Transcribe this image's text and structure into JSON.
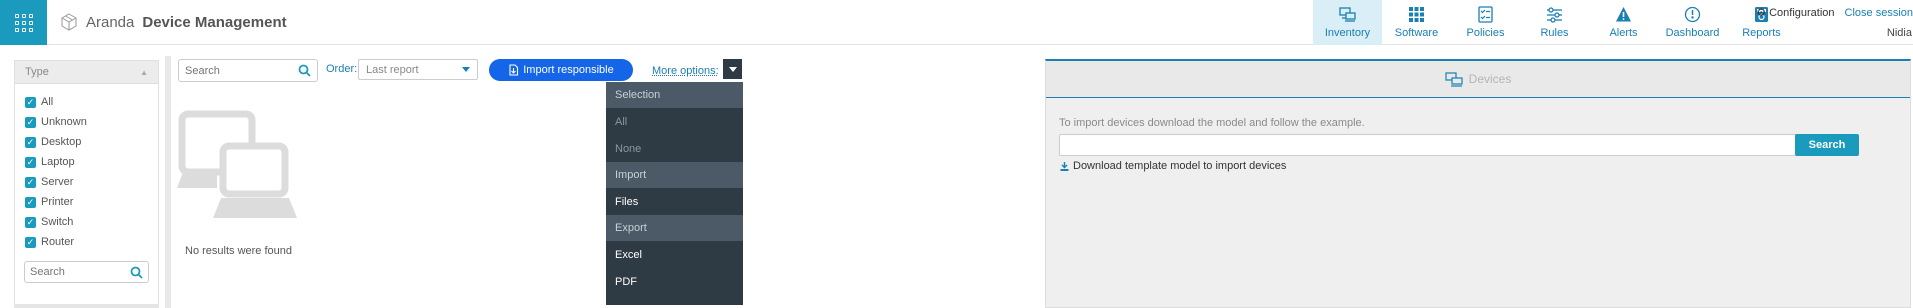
{
  "header": {
    "brand_light": "Aranda",
    "brand_bold": "Device Management",
    "nav": [
      {
        "label": "Inventory",
        "icon": "inventory-icon",
        "active": true
      },
      {
        "label": "Software",
        "icon": "software-icon",
        "active": false
      },
      {
        "label": "Policies",
        "icon": "policies-icon",
        "active": false
      },
      {
        "label": "Rules",
        "icon": "rules-icon",
        "active": false
      },
      {
        "label": "Alerts",
        "icon": "alerts-icon",
        "active": false
      },
      {
        "label": "Dashboard",
        "icon": "dashboard-icon",
        "active": false
      },
      {
        "label": "Reports",
        "icon": "reports-icon",
        "active": false
      }
    ],
    "configuration": "Configuration",
    "close_session": "Close session",
    "user": "Nidia"
  },
  "filter": {
    "title": "Type",
    "items": [
      "All",
      "Unknown",
      "Desktop",
      "Laptop",
      "Server",
      "Printer",
      "Switch",
      "Router"
    ],
    "search_placeholder": "Search"
  },
  "toolbar": {
    "search_placeholder": "Search",
    "order_label": "Order:",
    "order_value": "Last report",
    "import_label": "Import responsible",
    "more_options": "More options:"
  },
  "results": {
    "empty_text": "No results were found"
  },
  "menu": {
    "sections": [
      {
        "title": "Selection",
        "items": [
          {
            "label": "All",
            "disabled": true
          },
          {
            "label": "None",
            "disabled": true
          }
        ]
      },
      {
        "title": "Import",
        "items": [
          {
            "label": "Files",
            "disabled": false
          }
        ]
      },
      {
        "title": "Export",
        "items": [
          {
            "label": "Excel",
            "disabled": false
          },
          {
            "label": "PDF",
            "disabled": false
          }
        ]
      }
    ]
  },
  "import_panel": {
    "tab": "Devices",
    "info": "To import devices download the model and follow the example.",
    "search_button": "Search",
    "download_link": "Download template model to import devices"
  },
  "colors": {
    "accent": "#1a9bbd",
    "link": "#1a7fb3",
    "import_button": "#1565e8",
    "menu_bg": "#2e3a44"
  }
}
